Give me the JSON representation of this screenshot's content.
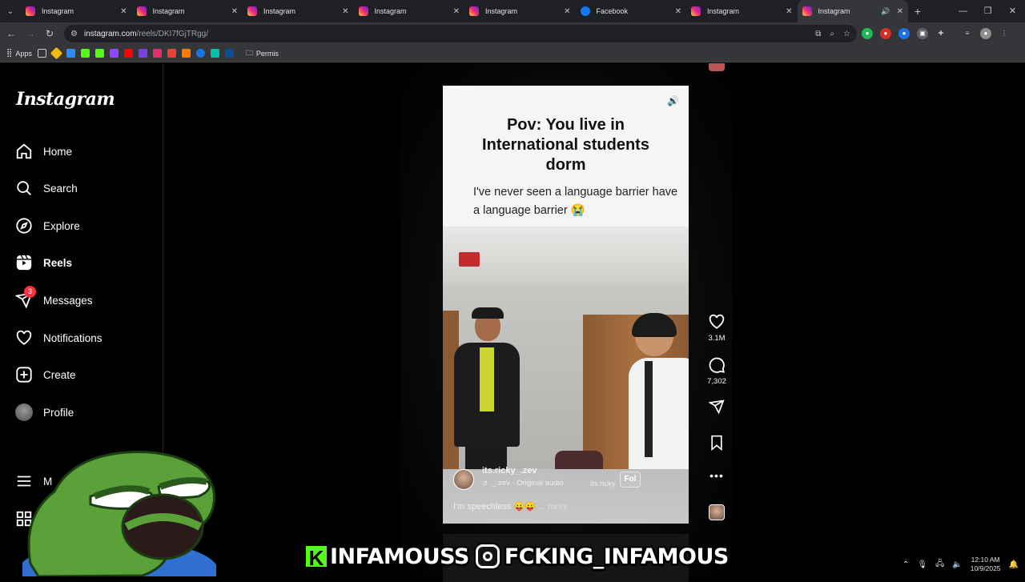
{
  "browser": {
    "tabs": [
      {
        "title": "Instagram",
        "type": "ig"
      },
      {
        "title": "Instagram",
        "type": "ig"
      },
      {
        "title": "Instagram",
        "type": "ig"
      },
      {
        "title": "Instagram",
        "type": "ig"
      },
      {
        "title": "Instagram",
        "type": "ig"
      },
      {
        "title": "Facebook",
        "type": "fb"
      },
      {
        "title": "Instagram",
        "type": "ig"
      },
      {
        "title": "Instagram",
        "type": "ig",
        "active": true
      }
    ],
    "url_host": "instagram.com",
    "url_path": "/reels/DKI7fGjTRgg/",
    "bookmarks": {
      "apps_label": "Apps",
      "folder_label": "Permis"
    }
  },
  "sidebar": {
    "logo": "Instagram",
    "items": [
      {
        "label": "Home",
        "icon": "home-icon"
      },
      {
        "label": "Search",
        "icon": "search-icon"
      },
      {
        "label": "Explore",
        "icon": "compass-icon"
      },
      {
        "label": "Reels",
        "icon": "reels-icon"
      },
      {
        "label": "Messages",
        "icon": "send-icon",
        "badge": "3"
      },
      {
        "label": "Notifications",
        "icon": "heart-icon"
      },
      {
        "label": "Create",
        "icon": "plus-square-icon"
      },
      {
        "label": "Profile",
        "icon": "avatar"
      }
    ],
    "more_label": "M"
  },
  "reel": {
    "title": "Pov:  You live in\nInternational students\ndorm",
    "subtitle": "I've never seen a language barrier have a language barrier 😭",
    "username": "its.ricky_.zev",
    "audio": "♬ _.zev · Original audio",
    "collab": "its.ricky",
    "follow_label": "Fol",
    "description": "I'm speechless 😛😛",
    "more_label": "... more"
  },
  "actions": {
    "likes": "3.1M",
    "comments": "7,302"
  },
  "overlay": {
    "kick_handle": "INFAMOUSS",
    "ig_handle": "FCKING_INFAMOUS"
  },
  "tray": {
    "time": "12:10 AM",
    "date": "10/9/2025"
  }
}
